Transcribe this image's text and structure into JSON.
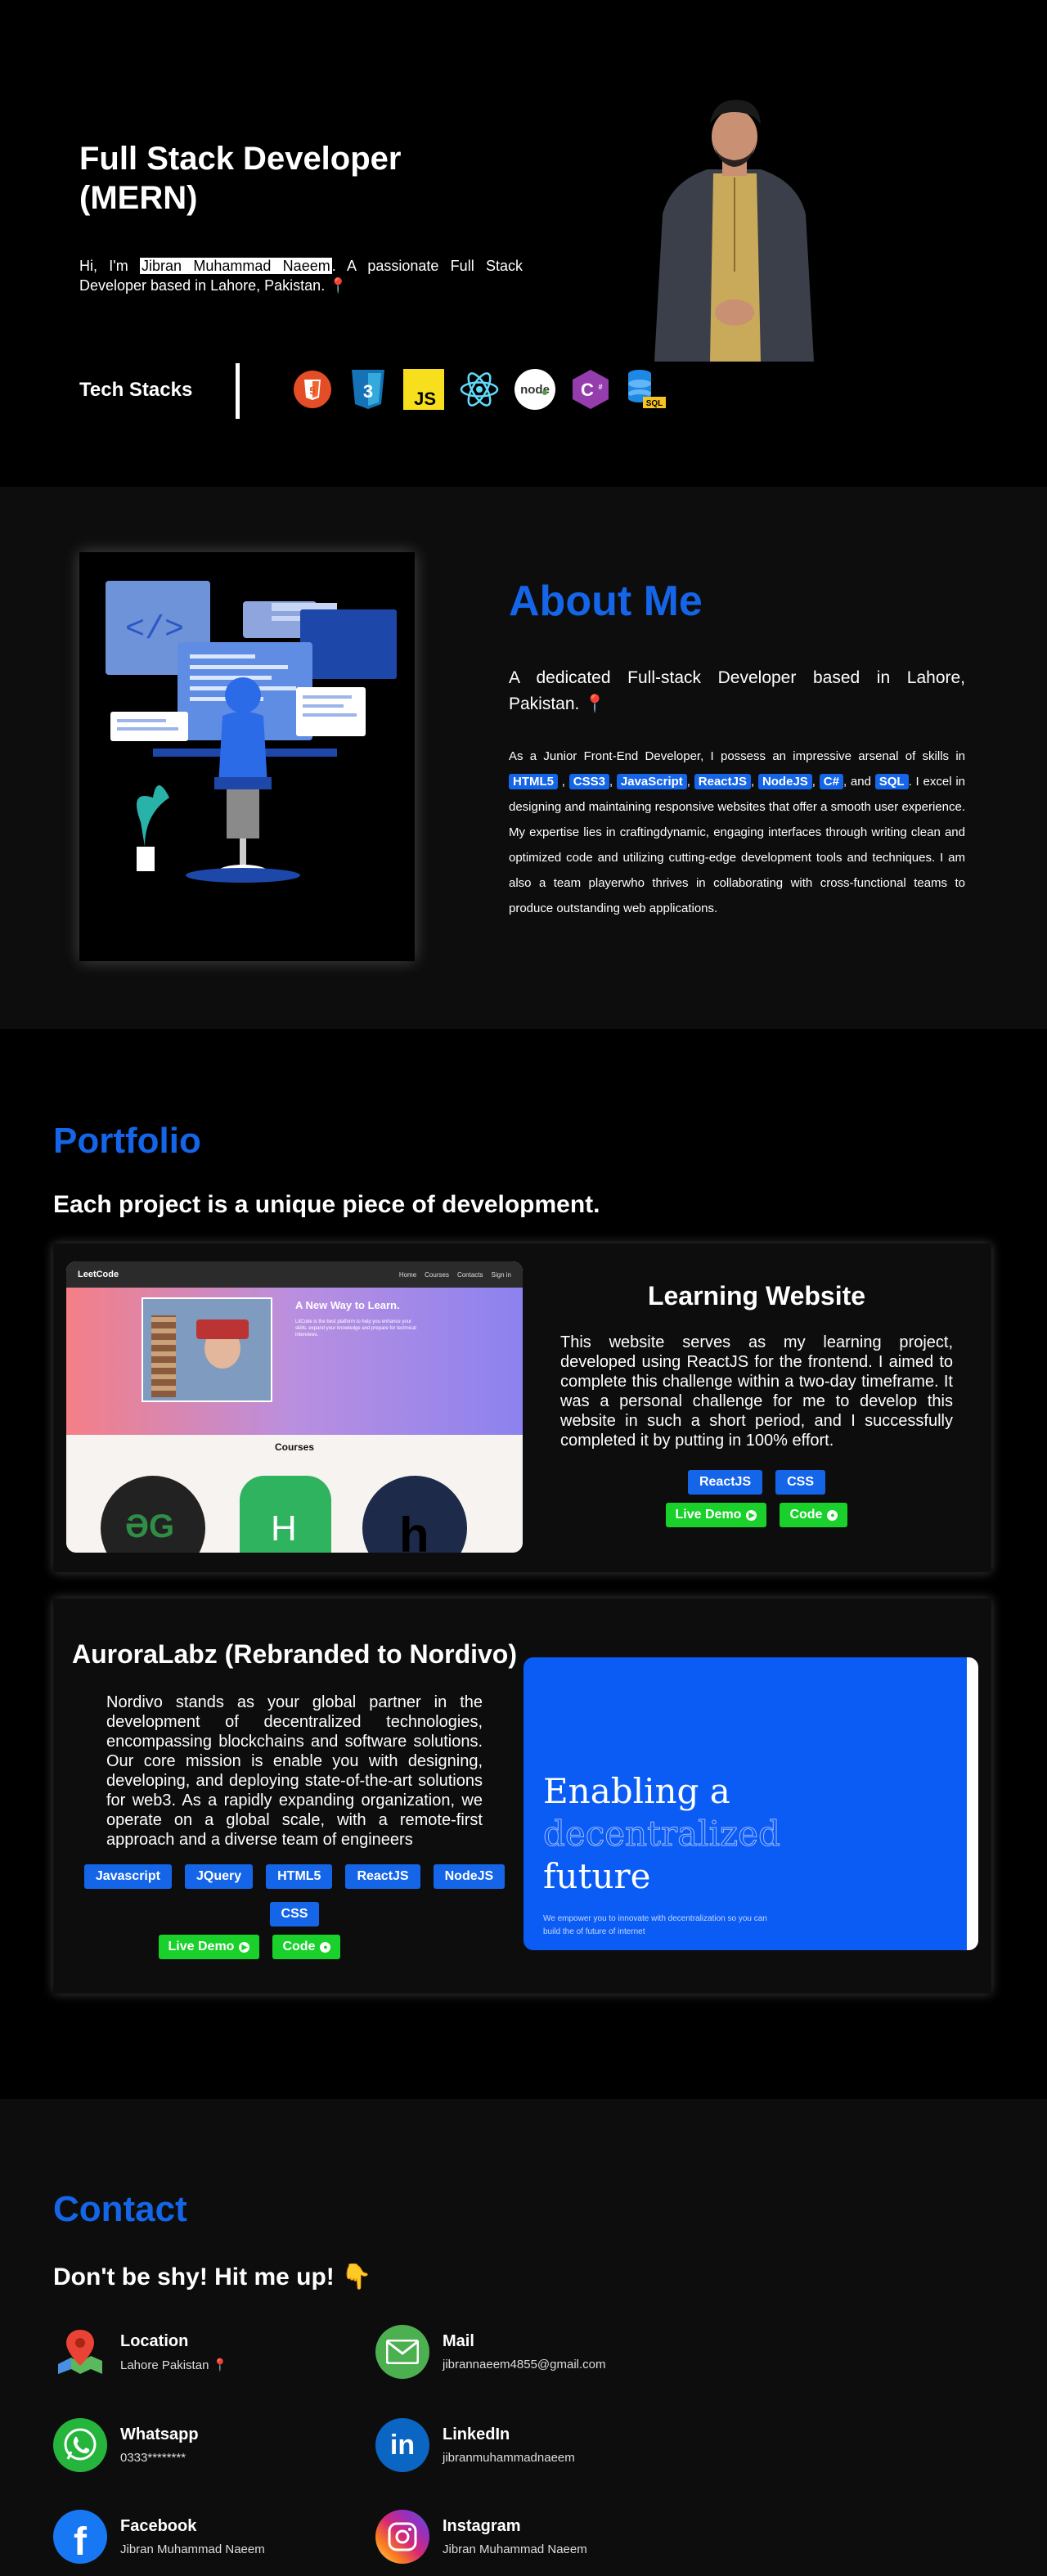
{
  "hero": {
    "title_line1": "Full Stack Developer",
    "title_line2": "(MERN)",
    "intro_prefix": "Hi, I'm ",
    "name": "Jibran Muhammad Naeem",
    "intro_suffix": ". A passionate Full Stack Developer based in Lahore, Pakistan. 📍",
    "tech_label": "Tech Stacks",
    "tech_icons": [
      "html5-icon",
      "css3-icon",
      "javascript-icon",
      "react-icon",
      "nodejs-icon",
      "csharp-icon",
      "sql-icon"
    ],
    "js_text": "JS",
    "sql_text": "SQL",
    "node_text": "node"
  },
  "about": {
    "title": "About Me",
    "lead": "A dedicated Full-stack Developer based in Lahore, Pakistan. 📍",
    "body_prefix": "As a Junior Front-End Developer, I possess an impressive arsenal of skills in",
    "skills": [
      "HTML5",
      "CSS3",
      "JavaScript",
      "ReactJS",
      "NodeJS",
      "C#",
      "SQL"
    ],
    "and_text": "and",
    "body_suffix": ". I excel in designing and maintaining responsive websites that offer a smooth user experience. My expertise lies in craftingdynamic, engaging interfaces through writing clean and optimized code and utilizing cutting-edge development tools and techniques. I am also a team playerwho thrives in collaborating with cross-functional teams to produce outstanding web applications."
  },
  "portfolio": {
    "title": "Portfolio",
    "subtitle": "Each project is a unique piece of development.",
    "projects": [
      {
        "title": "Learning Website",
        "description": "This website serves as my learning project, developed using ReactJS for the frontend. I aimed to complete this challenge within a two-day timeframe. It was a personal challenge for me to develop this website in such a short period, and I successfully completed it by putting in 100% effort.",
        "tags": [
          "ReactJS",
          "CSS"
        ],
        "live_label": "Live Demo",
        "code_label": "Code",
        "preview": {
          "brand": "LeetCode",
          "nav": [
            "Home",
            "Courses",
            "Contacts",
            "Sign in"
          ],
          "headline": "A New Way to Learn.",
          "blurb": "LitCode is the best platform to help you enhance your skills, expand your knowledge and prepare for technical interviews.",
          "section": "Courses"
        }
      },
      {
        "title": "AuroraLabz (Rebranded to Nordivo)",
        "description": "Nordivo stands as your global partner in the development of decentralized technologies, encompassing blockchains and software solutions. Our core mission is enable you with designing, developing, and deploying state-of-the-art solutions for web3. As a rapidly expanding organization, we operate on a global scale, with a remote-first approach and a diverse team of engineers",
        "tags": [
          "Javascript",
          "JQuery",
          "HTML5",
          "ReactJS",
          "NodeJS",
          "CSS"
        ],
        "live_label": "Live Demo",
        "code_label": "Code",
        "preview": {
          "line1": "Enabling a",
          "line2": "decentralized",
          "line3": "future",
          "small": "We empower you to innovate with decentralization so you can build the of future of internet"
        }
      }
    ]
  },
  "contact": {
    "title": "Contact",
    "subtitle": "Don't be shy! Hit me up! 👇",
    "items": [
      {
        "title": "Location",
        "value": "Lahore Pakistan 📍"
      },
      {
        "title": "Mail",
        "value": "jibrannaeem4855@gmail.com"
      },
      {
        "title": "Whatsapp",
        "value": "0333********"
      },
      {
        "title": "LinkedIn",
        "value": "jibranmuhammadnaeem"
      },
      {
        "title": "Facebook",
        "value": "Jibran Muhammad Naeem"
      },
      {
        "title": "Instagram",
        "value": "Jibran Muhammad Naeem"
      }
    ]
  },
  "colors": {
    "accent": "#1565e8",
    "button_green": "#19d12a",
    "background": "#000000",
    "section_alt": "#0d0d0d"
  }
}
